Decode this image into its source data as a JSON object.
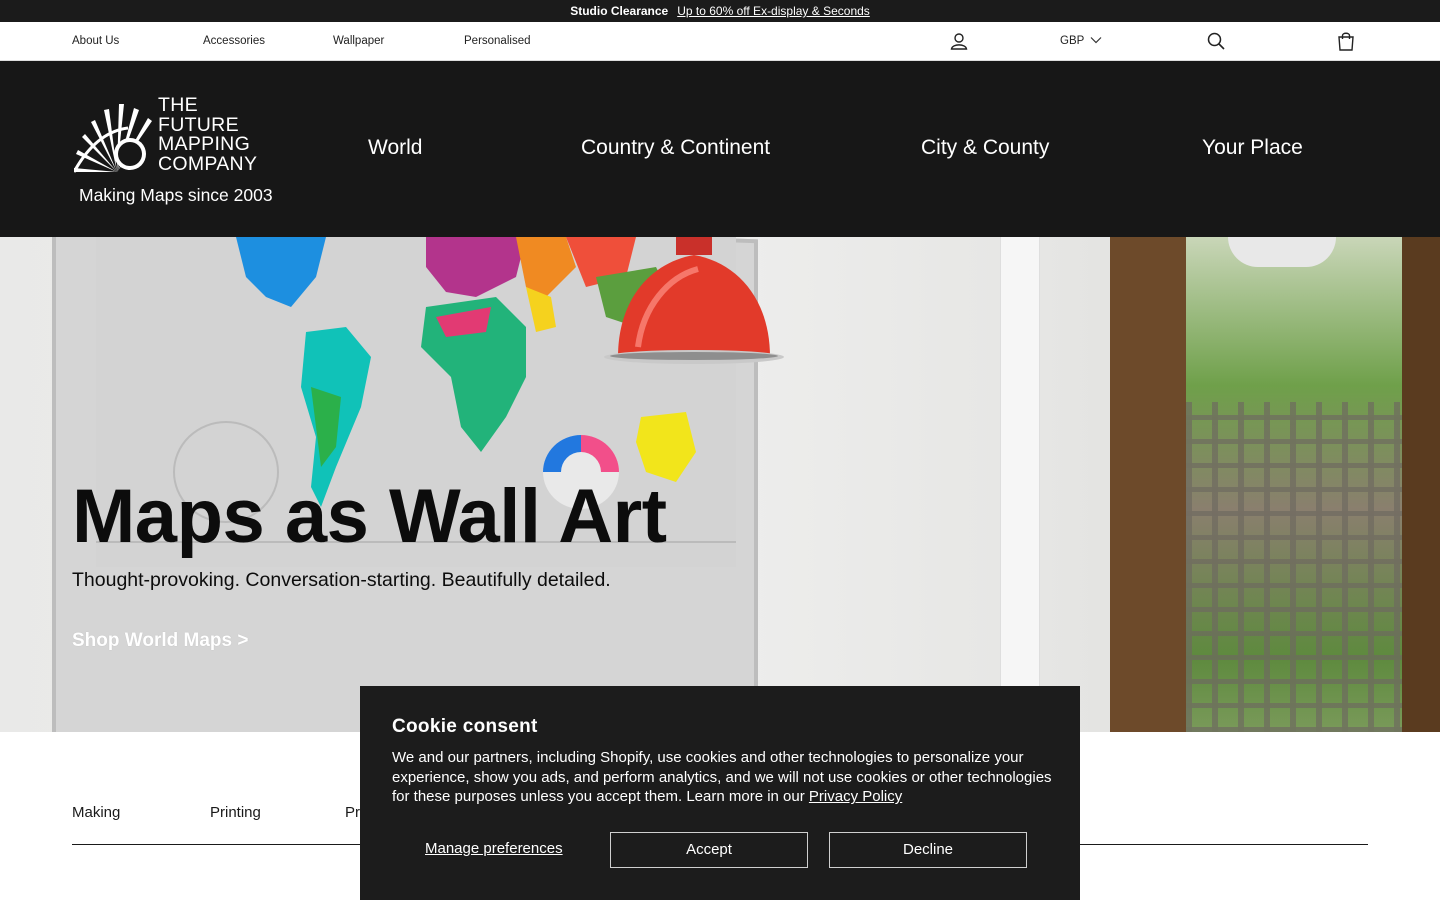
{
  "announcement": {
    "strong": "Studio Clearance",
    "link": "Up to 60% off Ex-display & Seconds"
  },
  "utility_nav": {
    "links": [
      "About Us",
      "Accessories",
      "Wallpaper",
      "Personalised"
    ],
    "currency": "GBP"
  },
  "brand": {
    "logo_lines": [
      "THE",
      "FUTURE",
      "MAPPING",
      "COMPANY"
    ],
    "tagline": "Making Maps since 2003"
  },
  "main_nav": [
    "World",
    "Country & Continent",
    "City & County",
    "Your Place"
  ],
  "hero": {
    "title": "Maps as Wall Art",
    "subtitle": "Thought-provoking. Conversation-starting. Beautifully detailed.",
    "cta": "Shop World Maps >"
  },
  "tabs": [
    "Making",
    "Printing",
    "Pro"
  ],
  "cookie": {
    "title": "Cookie consent",
    "message": "We and our partners, including Shopify, use cookies and other technologies to personalize your experience, show you ads, and perform analytics, and we will not use cookies or other technologies for these purposes unless you accept them. Learn more in our",
    "privacy_link": "Privacy Policy",
    "manage": "Manage preferences",
    "accept": "Accept",
    "decline": "Decline"
  },
  "colors": {
    "header_bg": "#171717",
    "announcement_bg": "#1b1b1b",
    "cookie_bg": "#1c1c1c",
    "lamp_red": "#e23a2a"
  },
  "icons": [
    "account-icon",
    "chevron-down-icon",
    "search-icon",
    "bag-icon",
    "sunburst-logo-icon"
  ]
}
